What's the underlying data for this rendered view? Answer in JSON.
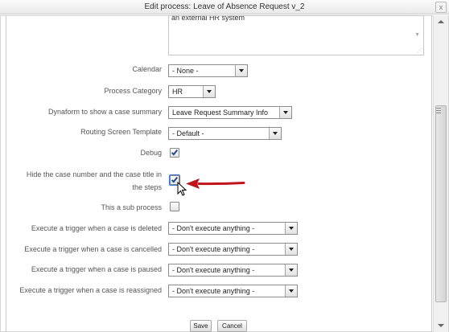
{
  "dialog": {
    "title": "Edit process: Leave of Absence Request v_2",
    "close_label": "x"
  },
  "description_field": {
    "visible_text": "an external HR system"
  },
  "fields": {
    "calendar": {
      "label": "Calendar",
      "value": "- None -"
    },
    "process_category": {
      "label": "Process Category",
      "value": "HR"
    },
    "dynaform_summary": {
      "label": "Dynaform to show a case summary",
      "value": "Leave Request Summary Info"
    },
    "routing_template": {
      "label": "Routing Screen Template",
      "value": "- Default -"
    },
    "debug": {
      "label": "Debug",
      "checked": true
    },
    "hide_case_number": {
      "label_line1": "Hide the case number and the case title in",
      "label_line2": "the steps",
      "checked": true
    },
    "sub_process": {
      "label": "This a sub process",
      "checked": false
    },
    "trigger_deleted": {
      "label": "Execute a trigger when a case is deleted",
      "value": "- Don't execute anything -"
    },
    "trigger_cancelled": {
      "label": "Execute a trigger when a case is cancelled",
      "value": "- Don't execute anything -"
    },
    "trigger_paused": {
      "label": "Execute a trigger when a case is paused",
      "value": "- Don't execute anything -"
    },
    "trigger_reassigned": {
      "label": "Execute a trigger when a case is reassigned",
      "value": "- Don't execute anything -"
    }
  },
  "buttons": {
    "save": "Save",
    "cancel": "Cancel"
  },
  "colors": {
    "annotation_arrow": "#c0141a",
    "checkbox_tick": "#254a8c"
  },
  "icons": {
    "pointer": "mouse-pointer-icon",
    "annotation": "red-arrow-icon"
  }
}
